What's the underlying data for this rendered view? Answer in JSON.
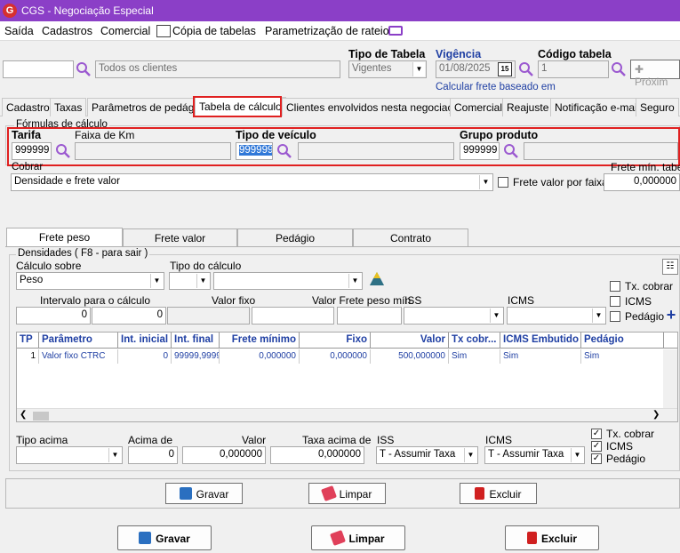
{
  "window": {
    "title": "CGS - Negociação Especial",
    "logo_letter": "G"
  },
  "menu": [
    "Saída",
    "Cadastros",
    "Comercial",
    "Cópia de tabelas",
    "Parametrização de rateio"
  ],
  "header": {
    "client_code": "",
    "client_name": "Todos os clientes",
    "tipo_tabela_label": "Tipo de Tabela",
    "tipo_tabela_value": "Vigentes",
    "vigencia_label": "Vigência",
    "vigencia_value": "01/08/2025",
    "calendar_day": "15",
    "codigo_tabela_label": "Código tabela",
    "codigo_tabela_value": "1",
    "proximo_label": "Próxim",
    "calcular_link": "Calcular frete baseado em"
  },
  "tabs": [
    "Cadastro",
    "Taxas",
    "Parâmetros de pedágio",
    "Tabela de cálculo",
    "Clientes envolvidos nesta negociação",
    "Comercial",
    "Reajuste",
    "Notificação e-mail",
    "Seguro"
  ],
  "formulas": {
    "group_label": "Fórmulas de cálculo",
    "tarifa_label": "Tarifa",
    "tarifa_value": "999999",
    "faixa_km_label": "Faixa de Km",
    "faixa_km_value": "",
    "tipo_veiculo_label": "Tipo de veículo",
    "tipo_veiculo_value": "999999",
    "grupo_produto_label": "Grupo produto",
    "grupo_produto_value": "999999"
  },
  "cobrar": {
    "label": "Cobrar",
    "value": "Densidade e frete valor",
    "faixas_label": "Frete valor por faixas",
    "frete_min_label": "Frete mín. tabela",
    "frete_min_value": "0,000000"
  },
  "subtabs": [
    "Frete peso",
    "Frete valor",
    "Pedágio",
    "Contrato"
  ],
  "densidades": {
    "group_label": "Densidades ( F8 - para sair )",
    "calculo_sobre_label": "Cálculo sobre",
    "calculo_sobre_value": "Peso",
    "tipo_calculo_label": "Tipo do cálculo",
    "intervalo_label": "Intervalo para o cálculo",
    "intervalo_de": "0",
    "intervalo_ate": "0",
    "valor_fixo_label": "Valor fixo",
    "valor_frete_label": "Valor Frete peso mín.",
    "iss_label": "ISS",
    "icms_label": "ICMS",
    "tx_cobrar_label": "Tx. cobrar",
    "icms_chk_label": "ICMS",
    "pedagio_chk_label": "Pedágio"
  },
  "grid": {
    "columns": [
      "TP",
      "Parâmetro",
      "Int. inicial",
      "Int. final",
      "Frete mínimo",
      "Fixo",
      "Valor",
      "Tx cobr...",
      "ICMS Embutido",
      "Pedágio"
    ],
    "rows": [
      [
        "1",
        "Valor fixo CTRC",
        "0",
        "99999,9999",
        "0,000000",
        "0,000000",
        "500,000000",
        "Sim",
        "Sim",
        "Sim"
      ]
    ]
  },
  "acima": {
    "tipo_acima_label": "Tipo acima",
    "acima_de_label": "Acima de",
    "acima_de_value": "0",
    "valor_label": "Valor",
    "valor_value": "0,000000",
    "taxa_acima_label": "Taxa acima de",
    "taxa_acima_value": "0,000000",
    "iss_label": "ISS",
    "iss_value": "T - Assumir Taxa",
    "icms_label": "ICMS",
    "icms_value": "T - Assumir Taxa",
    "tx_cobrar_label": "Tx. cobrar",
    "icms_chk_label": "ICMS",
    "pedagio_chk_label": "Pedágio"
  },
  "inner_buttons": {
    "gravar": "Gravar",
    "limpar": "Limpar",
    "excluir": "Excluir"
  },
  "outer_buttons": {
    "gravar": "Gravar",
    "limpar": "Limpar",
    "excluir": "Excluir"
  },
  "colors": {
    "titlebar": "#8b3fc7",
    "highlight": "#e02020",
    "link": "#1f3fa3"
  }
}
